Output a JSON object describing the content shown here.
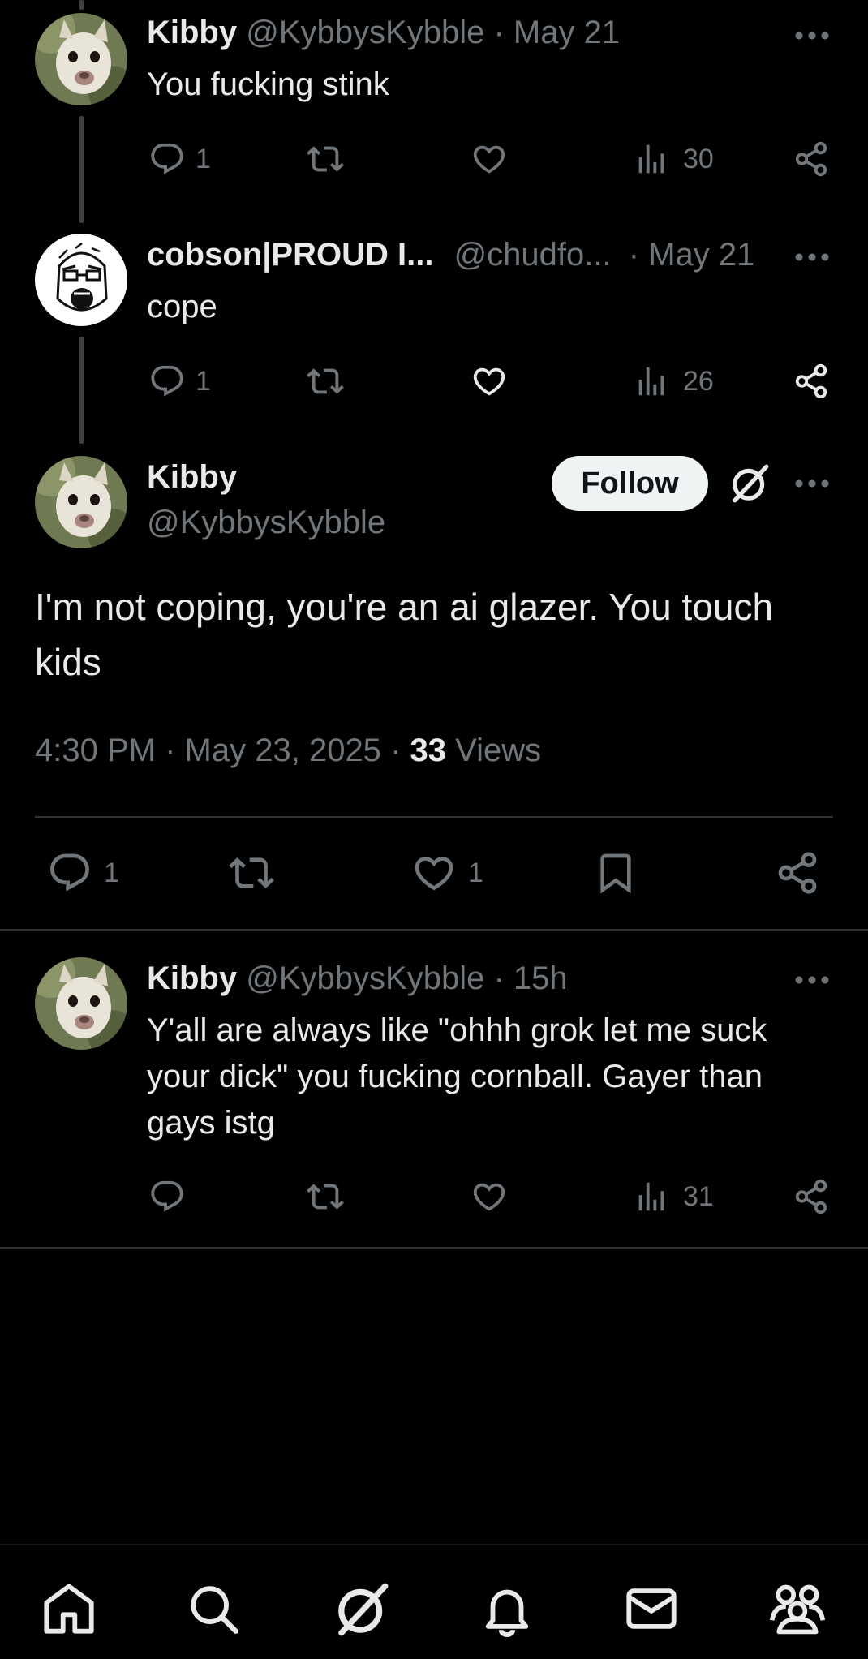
{
  "tweets": [
    {
      "name": "Kibby",
      "handle": "@KybbysKybble",
      "sep": "·",
      "time": "May 21",
      "text": "You fucking stink",
      "reply_count": "1",
      "view_count": "30"
    },
    {
      "name": "cobson|PROUD I...",
      "handle": "@chudfo...",
      "sep": "·",
      "time": "May 21",
      "text": "cope",
      "reply_count": "1",
      "view_count": "26"
    }
  ],
  "focused": {
    "name": "Kibby",
    "handle": "@KybbysKybble",
    "follow_label": "Follow",
    "text": "I'm not coping, you're an ai glazer. You touch kids",
    "time": "4:30 PM",
    "sep1": "·",
    "date": "May 23, 2025",
    "sep2": "·",
    "views_count": "33",
    "views_label": "Views",
    "reply_count": "1",
    "like_count": "1"
  },
  "reply": {
    "name": "Kibby",
    "handle": "@KybbysKybble",
    "sep": "·",
    "time": "15h",
    "text": "Y'all are always like \"ohhh grok let me suck your dick\" you fucking cornball. Gayer than gays istg",
    "view_count": "31"
  },
  "bottom_nav": [
    "home-icon",
    "search-icon",
    "grok-icon",
    "notifications-icon",
    "messages-icon",
    "communities-icon"
  ],
  "colors": {
    "background": "#000000",
    "text": "#e7e9ea",
    "muted": "#71767b",
    "divider": "#2f3336"
  }
}
